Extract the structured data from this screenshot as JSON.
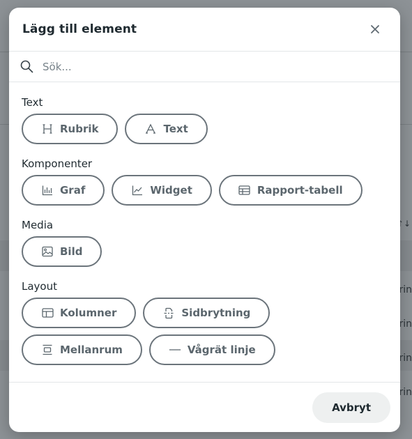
{
  "background": {
    "fragments": [
      "rin",
      "rin",
      "rin",
      "rin"
    ],
    "sort_glyph": "↑↓"
  },
  "modal": {
    "title": "Lägg till element",
    "close_label": "×",
    "search": {
      "placeholder": "Sök...",
      "value": ""
    },
    "sections": [
      {
        "title": "Text",
        "items": [
          {
            "label": "Rubrik",
            "icon": "heading-icon"
          },
          {
            "label": "Text",
            "icon": "text-icon"
          }
        ]
      },
      {
        "title": "Komponenter",
        "items": [
          {
            "label": "Graf",
            "icon": "bar-chart-icon"
          },
          {
            "label": "Widget",
            "icon": "line-chart-icon"
          },
          {
            "label": "Rapport-tabell",
            "icon": "table-icon"
          }
        ]
      },
      {
        "title": "Media",
        "items": [
          {
            "label": "Bild",
            "icon": "image-icon"
          }
        ]
      },
      {
        "title": "Layout",
        "items": [
          {
            "label": "Kolumner",
            "icon": "columns-icon"
          },
          {
            "label": "Sidbrytning",
            "icon": "page-break-icon"
          },
          {
            "label": "Mellanrum",
            "icon": "spacer-icon"
          },
          {
            "label": "Vågrät linje",
            "icon": "horizontal-line-icon"
          }
        ]
      }
    ],
    "footer": {
      "cancel_label": "Avbryt"
    }
  }
}
